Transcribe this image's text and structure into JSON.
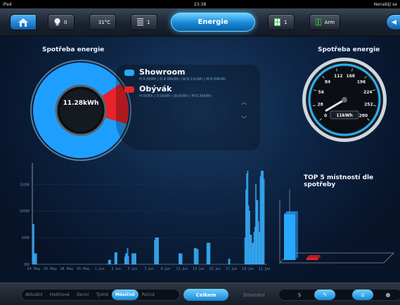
{
  "status_bar": {
    "device": "iPad",
    "time": "23:38",
    "right": "Nenabíjí se"
  },
  "topbar": {
    "items": [
      {
        "name": "light",
        "value": "0"
      },
      {
        "name": "temperature",
        "value": "31°C"
      },
      {
        "name": "blinds",
        "value": "1"
      },
      {
        "name": "rooms",
        "value": "1"
      },
      {
        "name": "security",
        "value": "Arm"
      }
    ],
    "active_tab": "Energie"
  },
  "donut": {
    "title": "Spotřeba energie",
    "total": "11.28kWh",
    "segments": [
      {
        "label": "Showroom",
        "fraction": 0.86,
        "color": "#1e9fff"
      },
      {
        "label": "Obývák",
        "fraction": 0.14,
        "color": "#e8232a"
      }
    ]
  },
  "legend": [
    {
      "name": "Showroom",
      "detail": "H:0.0kWh | D:4.06kWh | W:8.11kWh | M:8.64kWh",
      "color": "#29a8ff"
    },
    {
      "name": "Obývák",
      "detail": "H:0kWh | D:0kWh | W:0kWh | M:0.39kWh",
      "color": "#e8232a"
    }
  ],
  "gauge": {
    "title": "Spotřeba energie",
    "ticks": [
      "0",
      "28",
      "56",
      "84",
      "112",
      "168",
      "196",
      "224",
      "252",
      "280"
    ],
    "value": 10,
    "readout": "11kWh"
  },
  "chart_data": [
    {
      "type": "bar",
      "title": "",
      "xlabel": "",
      "ylabel": "",
      "ylim": [
        0,
        190
      ],
      "yticks": [
        "0W",
        "50W",
        "100W",
        "150W"
      ],
      "x_ticks": [
        "24. May",
        "26. May",
        "28. May",
        "30. May",
        "1. Jun",
        "3. Jun",
        "5. Jun",
        "7. Jun",
        "9. Jun",
        "11. Jun",
        "13. Jun",
        "15. Jun",
        "17. Jun",
        "19. Jun",
        "21. Jun"
      ],
      "values": [
        75,
        75,
        20,
        20,
        20,
        0,
        0,
        0,
        0,
        0,
        0,
        0,
        0,
        0,
        0,
        0,
        0,
        0,
        0,
        0,
        0,
        0,
        0,
        0,
        0,
        0,
        0,
        0,
        0,
        0,
        0,
        0,
        0,
        0,
        0,
        0,
        0,
        0,
        0,
        0,
        0,
        0,
        0,
        0,
        0,
        0,
        0,
        0,
        0,
        0,
        0,
        0,
        0,
        0,
        0,
        0,
        0,
        0,
        0,
        0,
        0,
        0,
        0,
        0,
        0,
        0,
        0,
        0,
        0,
        0,
        0,
        0,
        0,
        0,
        0,
        0,
        0,
        0,
        0,
        0,
        0,
        0,
        0,
        0,
        8,
        8,
        8,
        0,
        0,
        0,
        0,
        22,
        22,
        22,
        0,
        0,
        0,
        0,
        0,
        0,
        0,
        0,
        14,
        20,
        20,
        30,
        15,
        0,
        0,
        0,
        20,
        20,
        20,
        20,
        20,
        0,
        0,
        0,
        0,
        0,
        0,
        0,
        0,
        0,
        0,
        0,
        0,
        0,
        0,
        0,
        0,
        0,
        0,
        0,
        0,
        45,
        50,
        50,
        50,
        50,
        0,
        0,
        0,
        0,
        0,
        0,
        0,
        0,
        0,
        0,
        0,
        0,
        0,
        0,
        0,
        0,
        0,
        0,
        0,
        0,
        0,
        0,
        20,
        20,
        20,
        20,
        0,
        0,
        0,
        0,
        0,
        0,
        0,
        0,
        0,
        0,
        0,
        0,
        0,
        30,
        30,
        30,
        28,
        28,
        0,
        0,
        0,
        0,
        0,
        0,
        0,
        0,
        0,
        40,
        40,
        40,
        40,
        0,
        0,
        0,
        0,
        0,
        0,
        0,
        0,
        0,
        0,
        0,
        0,
        0,
        0,
        0,
        0,
        0,
        0,
        0,
        0,
        10,
        10,
        0,
        0,
        0,
        0,
        0,
        0,
        0,
        0,
        0,
        0,
        0,
        0,
        0,
        0,
        0,
        0,
        50,
        140,
        170,
        175,
        110,
        100,
        55,
        55,
        40,
        40,
        60,
        70,
        150,
        120,
        120,
        80,
        60,
        165,
        175,
        175,
        175,
        160,
        0,
        0,
        0
      ],
      "series_color": "#1f97e6"
    },
    {
      "type": "bar",
      "title": "TOP 5 místností dle spotřeby",
      "categories": [
        "Showroom",
        "Obývák"
      ],
      "values": [
        8.64,
        0.39
      ],
      "colors": [
        "#2aa7ff",
        "#e8232a"
      ],
      "ylim": [
        0,
        9
      ]
    }
  ],
  "bottombar": {
    "periods": [
      "Aktuální",
      "Hodinové",
      "Denní",
      "Týdně",
      "Měsíčně",
      "Ročně"
    ],
    "active_period": "Měsíčně",
    "celkem": "Celkem",
    "srovnani": "Srovnání",
    "icons": [
      "dollar-icon",
      "bolt-icon",
      "home-icon",
      "bulb-icon"
    ]
  }
}
